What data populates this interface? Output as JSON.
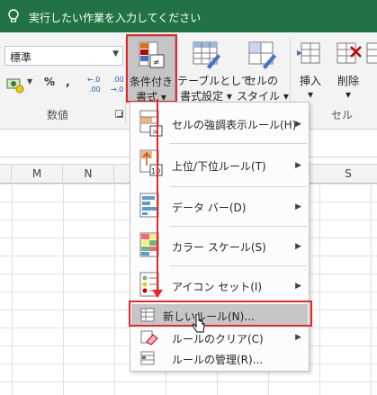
{
  "titlebar": {
    "tell_me": "実行したい作業を入力してください"
  },
  "ribbon": {
    "number_format": "標準",
    "percent": "%",
    "comma": ",",
    "dec_up": ".00 →.0",
    "dec_down": ".00 →.0",
    "group_number": "数値",
    "group_cells": "セル",
    "conditional_formatting": {
      "line1": "条件付き",
      "line2": "書式"
    },
    "format_as_table": {
      "line1": "テーブルとして",
      "line2": "書式設定"
    },
    "cell_styles": {
      "line1": "セルの",
      "line2": "スタイル"
    },
    "insert": "挿入",
    "delete": "削除"
  },
  "columns": [
    "M",
    "N",
    "S"
  ],
  "menu": {
    "items": [
      {
        "label": "セルの強調表示ルール(H)",
        "icon": "highlight-rules-icon",
        "submenu": true
      },
      {
        "label": "上位/下位ルール(T)",
        "icon": "top-bottom-rules-icon",
        "submenu": true
      },
      {
        "label": "データ バー(D)",
        "icon": "data-bars-icon",
        "submenu": true
      },
      {
        "label": "カラー スケール(S)",
        "icon": "color-scales-icon",
        "submenu": true
      },
      {
        "label": "アイコン セット(I)",
        "icon": "icon-sets-icon",
        "submenu": true
      },
      {
        "label": "新しいルール(N)...",
        "icon": "new-rule-icon",
        "submenu": false
      },
      {
        "label": "ルールのクリア(C)",
        "icon": "clear-rules-icon",
        "submenu": true
      },
      {
        "label": "ルールの管理(R)...",
        "icon": "manage-rules-icon",
        "submenu": false
      }
    ]
  },
  "colors": {
    "accent": "#217346",
    "annotation": "#e8262b",
    "hover": "#c6c6c6"
  }
}
